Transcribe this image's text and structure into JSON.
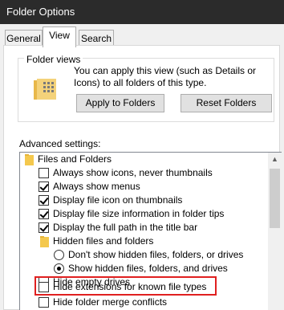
{
  "window": {
    "title": "Folder Options"
  },
  "tabs": [
    {
      "label": "General",
      "active": false
    },
    {
      "label": "View",
      "active": true
    },
    {
      "label": "Search",
      "active": false
    }
  ],
  "folder_views": {
    "heading": "Folder views",
    "description": "You can apply this view (such as Details or Icons) to all folders of this type.",
    "apply_button": "Apply to Folders",
    "reset_button": "Reset Folders"
  },
  "advanced": {
    "label": "Advanced settings:",
    "items": [
      {
        "type": "folder",
        "label": "Files and Folders"
      },
      {
        "type": "checkbox",
        "checked": false,
        "label": "Always show icons, never thumbnails"
      },
      {
        "type": "checkbox",
        "checked": true,
        "label": "Always show menus"
      },
      {
        "type": "checkbox",
        "checked": true,
        "label": "Display file icon on thumbnails"
      },
      {
        "type": "checkbox",
        "checked": true,
        "label": "Display file size information in folder tips"
      },
      {
        "type": "checkbox",
        "checked": true,
        "label": "Display the full path in the title bar"
      },
      {
        "type": "folder",
        "label": "Hidden files and folders"
      },
      {
        "type": "radio",
        "selected": false,
        "label": "Don't show hidden files, folders, or drives"
      },
      {
        "type": "radio",
        "selected": true,
        "label": "Show hidden files, folders, and drives"
      },
      {
        "type": "checkbox",
        "checked": false,
        "label": "Hide empty drives"
      },
      {
        "type": "checkbox",
        "checked": false,
        "label": "Hide extensions for known file types"
      },
      {
        "type": "checkbox",
        "checked": false,
        "label": "Hide folder merge conflicts"
      }
    ]
  },
  "colors": {
    "titlebar": "#2b2b2b",
    "highlight_border": "#e02020",
    "folder": "#f4c84d"
  }
}
